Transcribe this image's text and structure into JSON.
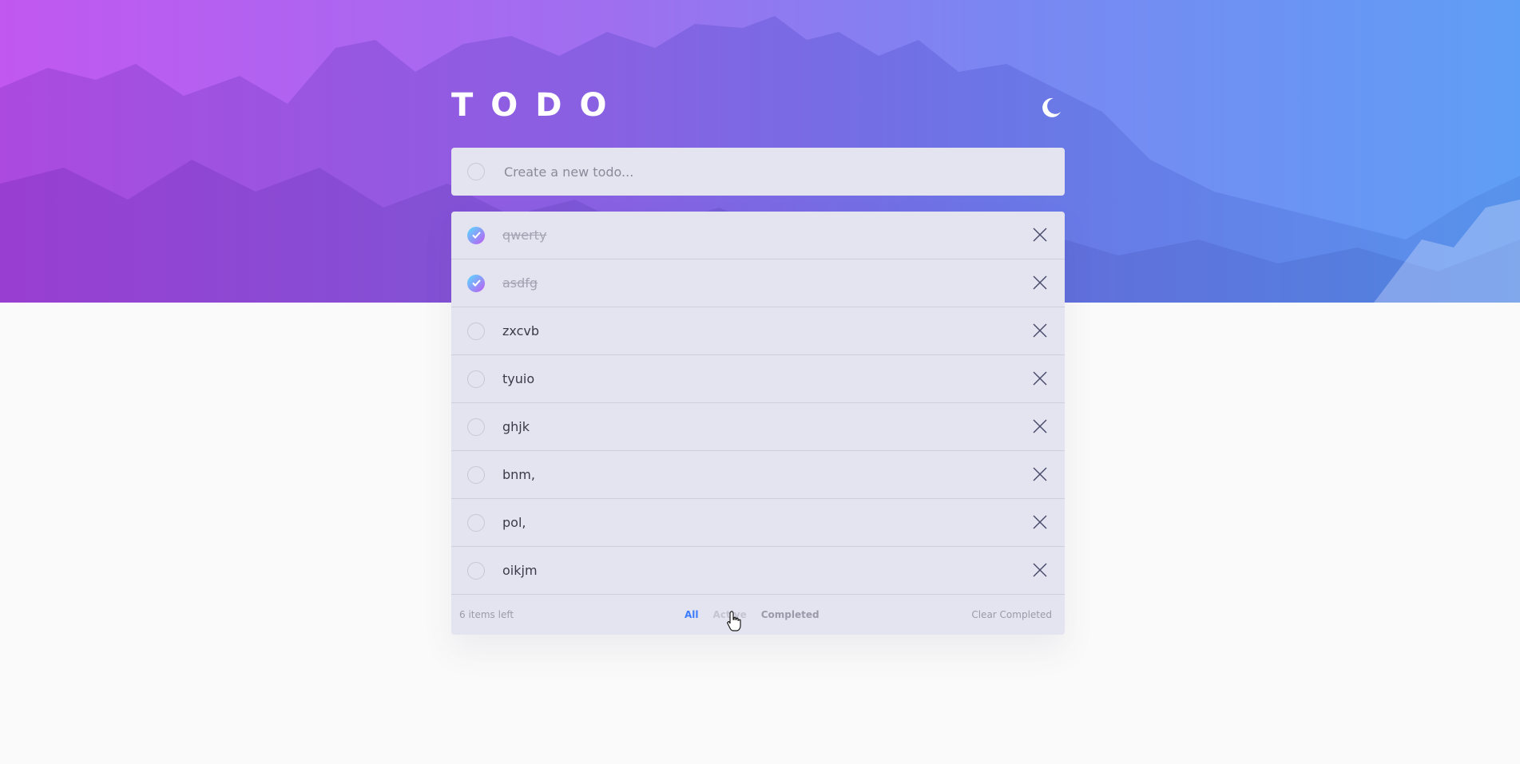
{
  "app": {
    "title": "TODO",
    "theme_icon": "moon-icon"
  },
  "new_todo": {
    "placeholder": "Create a new todo..."
  },
  "todos": [
    {
      "text": "qwerty",
      "completed": true
    },
    {
      "text": "asdfg",
      "completed": true
    },
    {
      "text": "zxcvb",
      "completed": false
    },
    {
      "text": "tyuio",
      "completed": false
    },
    {
      "text": "ghjk",
      "completed": false
    },
    {
      "text": "bnm,",
      "completed": false
    },
    {
      "text": "pol,",
      "completed": false
    },
    {
      "text": "oikjm",
      "completed": false
    }
  ],
  "footer": {
    "items_left": "6 items left",
    "filter_all": "All",
    "filter_active": "Active",
    "filter_completed": "Completed",
    "clear_completed": "Clear Completed",
    "selected_filter": "All"
  },
  "colors": {
    "accent": "#3a7bfd",
    "check_gradient_start": "#57ddff",
    "check_gradient_end": "#c058f3",
    "hero_gradient_start": "#c158f0",
    "hero_gradient_end": "#5f9ef5"
  }
}
